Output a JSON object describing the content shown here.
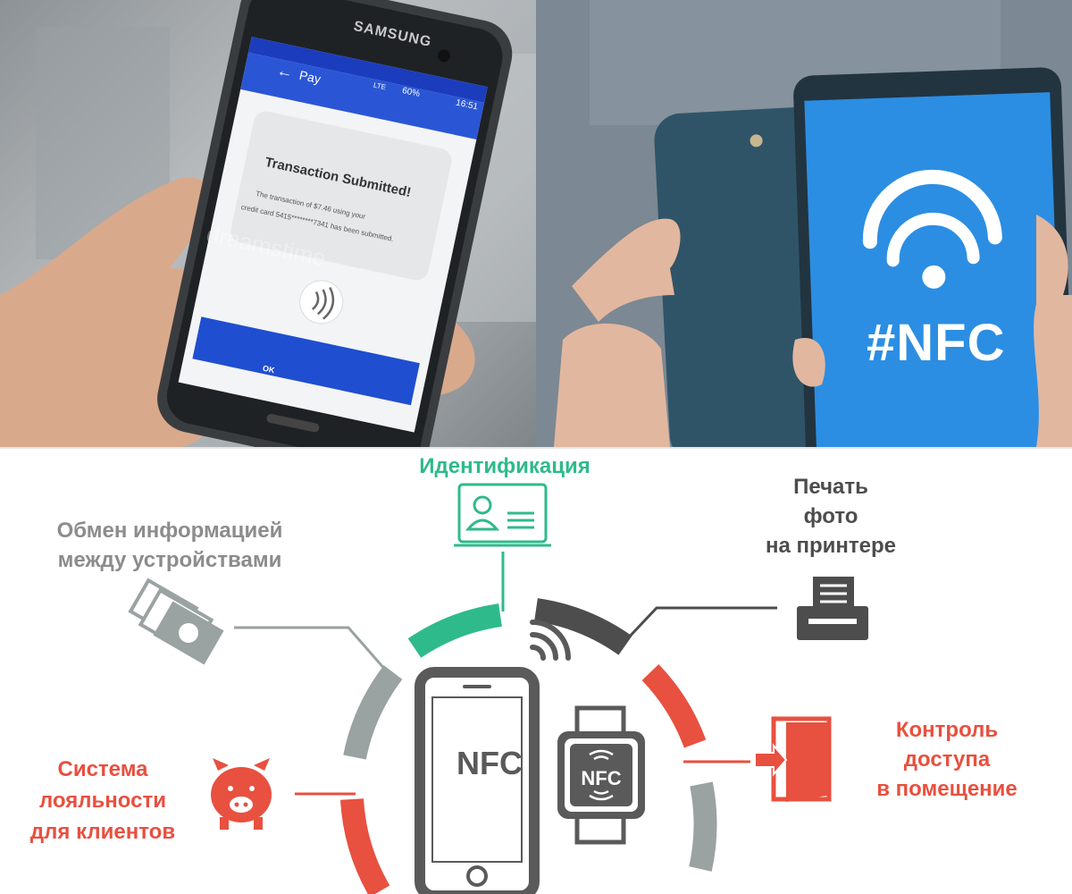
{
  "left_photo": {
    "brand": "SAMSUNG",
    "status_bar": {
      "battery": "60%",
      "time": "16:51",
      "network": "LTE"
    },
    "app_title": "Pay",
    "card_title": "Transaction Submitted!",
    "card_text_1": "The transaction of $7.46 using your",
    "card_text_2": "credit card 5415********7341 has been submitted.",
    "ok_label": "OK",
    "watermark": "dreamstime"
  },
  "right_photo": {
    "screen_label": "#NFC"
  },
  "diagram": {
    "labels": {
      "identification": "Идентификация",
      "exchange_1": "Обмен информацией",
      "exchange_2": "между устройствами",
      "print_1": "Печать",
      "print_2": "фото",
      "print_3": "на принтере",
      "loyalty_1": "Система",
      "loyalty_2": "лояльности",
      "loyalty_3": "для клиентов",
      "access_1": "Контроль",
      "access_2": "доступа",
      "access_3": "в помещение"
    },
    "phone_label": "NFC",
    "watch_label": "NFC",
    "colors": {
      "green": "#2fba8b",
      "red": "#e8503f",
      "dark": "#4d4d4d",
      "grey": "#9aa2a2"
    }
  }
}
